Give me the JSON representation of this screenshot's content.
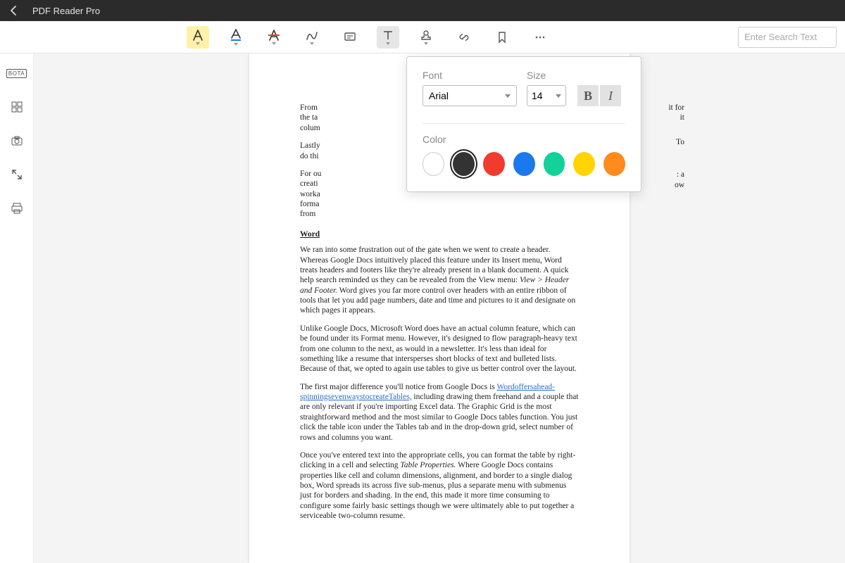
{
  "titlebar": {
    "app_name": "PDF Reader Pro"
  },
  "toolbar": {
    "search_placeholder": "Enter Search Text"
  },
  "sidestrip": {
    "bota_label": "BOTA"
  },
  "popup": {
    "font_label": "Font",
    "size_label": "Size",
    "font_value": "Arial",
    "size_value": "14",
    "bold_label": "B",
    "italic_label": "I",
    "color_label": "Color",
    "swatches": [
      "#ffffff",
      "#333333",
      "#f13b2d",
      "#1b79ef",
      "#12d19a",
      "#ffd400",
      "#ff8a1e"
    ],
    "selected_swatch_index": 1
  },
  "document": {
    "p1_a": "From",
    "p1_b": "the ta",
    "p1_c": "colum",
    "p2_a": "Lastly",
    "p2_b": "do thi",
    "p3_a": "For ou",
    "p3_b": "creati",
    "p3_c": "worka",
    "p3_d": "forma",
    "p3_e": "from ",
    "heading": "Word",
    "p4": "We ran into some frustration out of the gate when we went to create a header. Whereas Google Docs intuitively placed this feature under its Insert menu, Word treats headers and footers like they're already present in a blank document. A quick help search reminded us they can be revealed from the View menu: ",
    "p4_em": "View > Header and Footer.",
    "p4_tail": " Word gives you far more control over headers with an entire ribbon of tools that let you add page numbers, date and time and pictures to it and designate on which pages it appears.",
    "p5": "Unlike Google Docs, Microsoft Word does have an actual column feature, which can be found under its Format menu. However, it's designed to flow paragraph-heavy text from one column to the next, as would in a newsletter. It's less than ideal for something like a resume that intersperses short blocks of text and bulleted lists. Because of that, we opted to again use tables to give us better control over the layout.",
    "p6_a": "The first major difference you'll notice from Google Docs is ",
    "p6_link": "Wordoffersahead-spinningsevenwaystocreateTables,",
    "p6_b": " including drawing them freehand and a couple that are only relevant if you're importing Excel data. The Graphic Grid is the most straightforward method and the most similar to Google Docs tables function. You just click the table icon under the Tables tab and in the drop-down grid, select number of rows and columns you want.",
    "p7_a": "Once you've entered text into the appropriate cells, you can format the table by right-clicking in a cell and selecting ",
    "p7_em": "Table Properties.",
    "p7_b": " Where Google Docs contains properties like cell and column dimensions, alignment, and border to a single dialog box, Word spreads its across five sub-menus, plus a separate menu with submenus just for borders and shading. In the end, this made it more time consuming to configure some fairly basic settings though we were ultimately able to put together a serviceable two-column resume.",
    "peek1": "it for",
    "peek1b": "it",
    "peek2": "To",
    "peek3": ": a",
    "peek3b": "ow"
  }
}
